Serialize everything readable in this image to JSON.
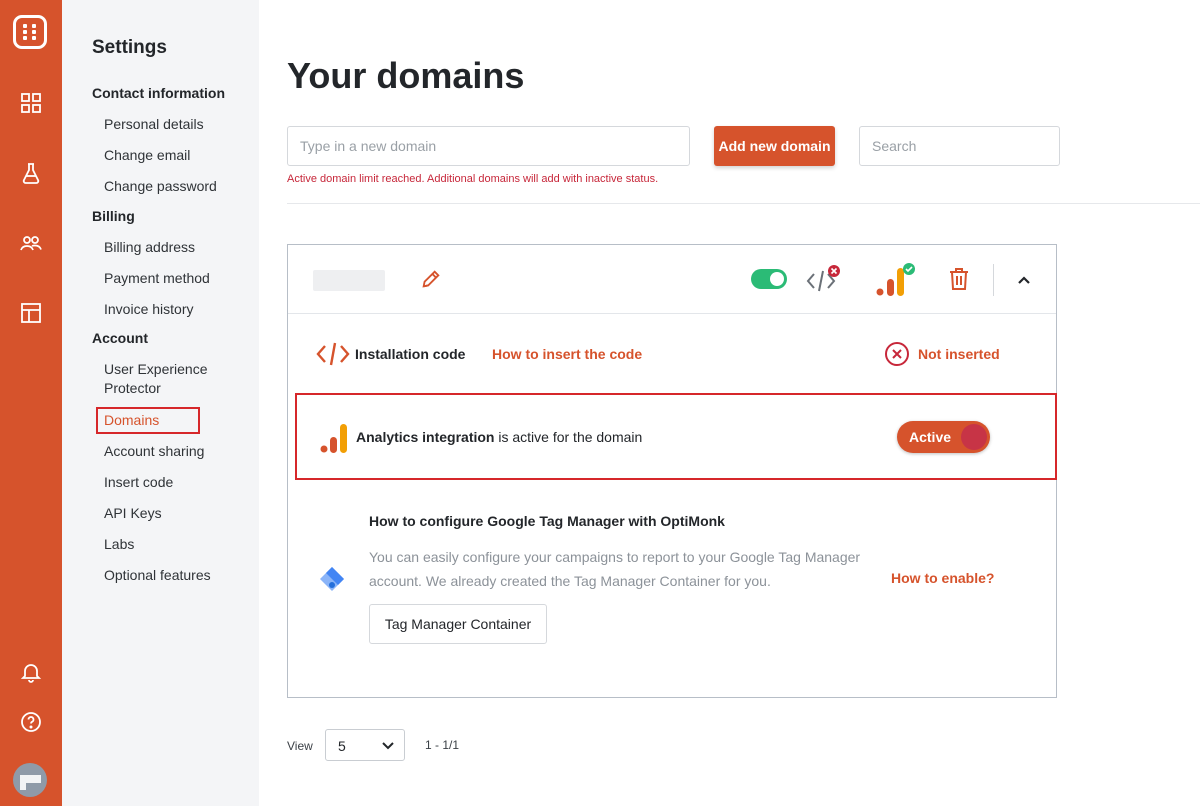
{
  "rail": {
    "icons": [
      "optimonk-logo-icon",
      "dashboard-icon",
      "flask-icon",
      "users-icon",
      "templates-icon",
      "bell-icon",
      "help-icon",
      "avatar"
    ]
  },
  "sidebar": {
    "title": "Settings",
    "sections": [
      {
        "label": "Contact information",
        "items": [
          "Personal details",
          "Change email",
          "Change password"
        ]
      },
      {
        "label": "Billing",
        "items": [
          "Billing address",
          "Payment method",
          "Invoice history"
        ]
      },
      {
        "label": "Account",
        "items": [
          "User Experience Protector",
          "Domains",
          "Account sharing",
          "Insert code",
          "API Keys",
          "Labs",
          "Optional features"
        ]
      }
    ],
    "active_item": "Domains"
  },
  "main": {
    "title": "Your domains",
    "domain_input_placeholder": "Type in a new domain",
    "add_button": "Add new domain",
    "search_placeholder": "Search",
    "warning": "Active domain limit reached. Additional domains will add with inactive status."
  },
  "domain_card": {
    "installation": {
      "label": "Installation code",
      "link": "How to insert the code",
      "status": "Not inserted"
    },
    "analytics": {
      "bold": "Analytics integration",
      "rest": " is active for the domain",
      "toggle_label": "Active"
    },
    "gtm": {
      "title": "How to configure Google Tag Manager with OptiMonk",
      "description": "You can easily configure your campaigns to report to your Google Tag Manager account. We already created the Tag Manager Container for you.",
      "button": "Tag Manager Container",
      "link": "How to enable?"
    }
  },
  "pagination": {
    "view_label": "View",
    "per_page": "5",
    "range": "1 - 1/1"
  },
  "colors": {
    "accent": "#d6532c",
    "error": "#c7273a",
    "success": "#2bbb76",
    "analytics_orange": "#f29f05"
  }
}
